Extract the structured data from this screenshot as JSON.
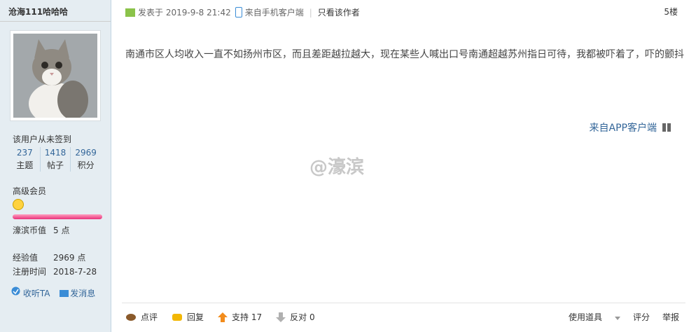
{
  "sidebar": {
    "username": "沧海111哈哈哈",
    "sign_status": "该用户从未签到",
    "stats": [
      {
        "num": "237",
        "label": "主题"
      },
      {
        "num": "1418",
        "label": "帖子"
      },
      {
        "num": "2969",
        "label": "积分"
      }
    ],
    "rank": "高级会员",
    "coin_label": "濠滨币值",
    "coin_value": "5 点",
    "exp_label": "经验值",
    "exp_value": "2969 点",
    "reg_label": "注册时间",
    "reg_value": "2018-7-28",
    "fav_label": "收听TA",
    "msg_label": "发消息"
  },
  "post": {
    "posted_prefix": "发表于",
    "posted_time": "2019-9-8 21:42",
    "from_mobile": "来自手机客户端",
    "only_author": "只看该作者",
    "floor": "5楼",
    "body": "南通市区人均收入一直不如扬州市区，而且差距越拉越大，现在某些人喊出口号南通超越苏州指日可待，我都被吓着了，吓的颤抖",
    "from_app": "来自APP客户端",
    "watermark": "@濠滨"
  },
  "footer": {
    "comment": "点评",
    "reply": "回复",
    "support": "支持",
    "support_count": "17",
    "oppose": "反对",
    "oppose_count": "0",
    "tools": "使用道具",
    "rate": "评分",
    "report": "举报"
  }
}
